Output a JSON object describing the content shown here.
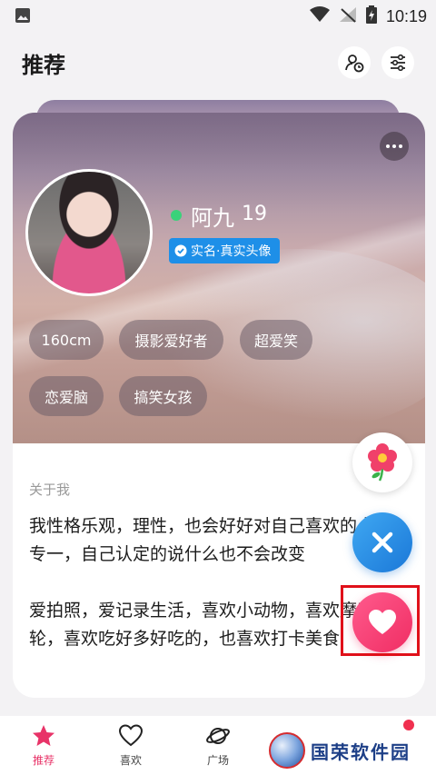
{
  "status_bar": {
    "time": "10:19"
  },
  "header": {
    "title": "推荐"
  },
  "profile": {
    "name": "阿九",
    "age": "19",
    "verify": "实名·真实头像",
    "tags": [
      "160cm",
      "摄影爱好者",
      "超爱笑",
      "恋爱脑",
      "搞笑女孩"
    ],
    "about_label": "关于我",
    "about_text": "我性格乐观，理性，也会好好对自己喜欢的人，专一，自己认定的说什么也不会改变\n\n爱拍照，爱记录生活，喜欢小动物，喜欢摩天轮，喜欢吃好多好吃的，也喜欢打卡美食"
  },
  "nav": {
    "items": [
      {
        "label": "推荐"
      },
      {
        "label": "喜欢"
      },
      {
        "label": "广场"
      }
    ]
  },
  "watermark": "国荣软件园",
  "colors": {
    "accent": "#e83368",
    "verify": "#1e8fe8",
    "close": "#1b78d8",
    "like": "#f02d63"
  }
}
